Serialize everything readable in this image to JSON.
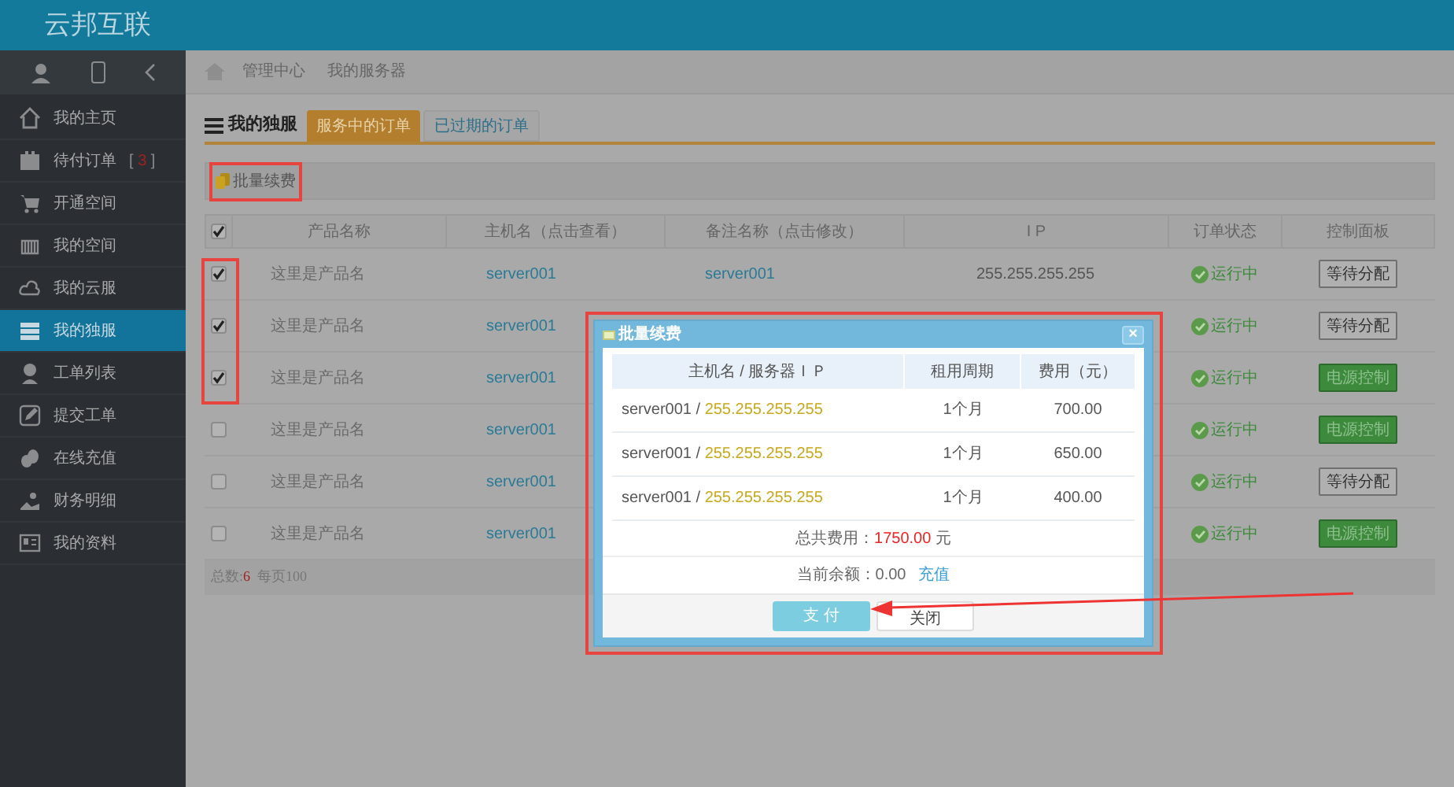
{
  "app": {
    "title": "云邦互联"
  },
  "sidebar": {
    "items": [
      {
        "label": "我的主页",
        "selected": false
      },
      {
        "label": "待付订单",
        "badge_open": "[",
        "badge": "3",
        "badge_close": "]",
        "selected": false
      },
      {
        "label": "开通空间",
        "selected": false
      },
      {
        "label": "我的空间",
        "selected": false
      },
      {
        "label": "我的云服",
        "selected": false
      },
      {
        "label": "我的独服",
        "selected": true
      },
      {
        "label": "工单列表",
        "selected": false
      },
      {
        "label": "提交工单",
        "selected": false
      },
      {
        "label": "在线充值",
        "selected": false
      },
      {
        "label": "财务明细",
        "selected": false
      },
      {
        "label": "我的资料",
        "selected": false
      }
    ]
  },
  "breadcrumb": [
    "管理中心",
    "我的服务器"
  ],
  "section": {
    "title": "我的独服",
    "tabs": [
      {
        "label": "服务中的订单",
        "selected": true
      },
      {
        "label": "已过期的订单",
        "selected": false
      }
    ]
  },
  "toolbar": {
    "button": "批量续费"
  },
  "table": {
    "all_checked": true,
    "columns": [
      "产品名称",
      "主机名（点击查看）",
      "备注名称（点击修改）",
      "I P",
      "订单状态",
      "控制面板"
    ],
    "rows": [
      {
        "checked": true,
        "product": "这里是产品名",
        "host": "server001",
        "remark": "server001",
        "ip": "255.255.255.255",
        "status": "运行中",
        "control": {
          "label": "等待分配",
          "kind": "pending"
        }
      },
      {
        "checked": true,
        "product": "这里是产品名",
        "host": "server001",
        "status": "运行中",
        "control": {
          "label": "等待分配",
          "kind": "pending"
        }
      },
      {
        "checked": true,
        "product": "这里是产品名",
        "host": "server001",
        "status": "运行中",
        "control": {
          "label": "电源控制",
          "kind": "power"
        }
      },
      {
        "checked": false,
        "product": "这里是产品名",
        "host": "server001",
        "status": "运行中",
        "control": {
          "label": "电源控制",
          "kind": "power"
        }
      },
      {
        "checked": false,
        "product": "这里是产品名",
        "host": "server001",
        "status": "运行中",
        "control": {
          "label": "等待分配",
          "kind": "pending"
        }
      },
      {
        "checked": false,
        "product": "这里是产品名",
        "host": "server001",
        "status": "运行中",
        "control": {
          "label": "电源控制",
          "kind": "power"
        }
      }
    ],
    "footer": {
      "total_label": "总数:",
      "total": "6",
      "per_page": "每页100"
    }
  },
  "modal": {
    "title": "批量续费",
    "close": "×",
    "columns": [
      "主机名 / 服务器ＩＰ",
      "租用周期",
      "费用（元）"
    ],
    "rows": [
      {
        "host": "server001",
        "separator": "/",
        "ip": "255.255.255.255",
        "period": "1个月",
        "fee": "700.00"
      },
      {
        "host": "server001",
        "separator": "/",
        "ip": "255.255.255.255",
        "period": "1个月",
        "fee": "650.00"
      },
      {
        "host": "server001",
        "separator": "/",
        "ip": "255.255.255.255",
        "period": "1个月",
        "fee": "400.00"
      }
    ],
    "total_label": "总共费用：",
    "total": "1750.00",
    "unit": "元",
    "balance_label": "当前余额：",
    "balance": "0.00",
    "recharge": "充值",
    "pay": "支 付",
    "cancel": "关闭"
  }
}
